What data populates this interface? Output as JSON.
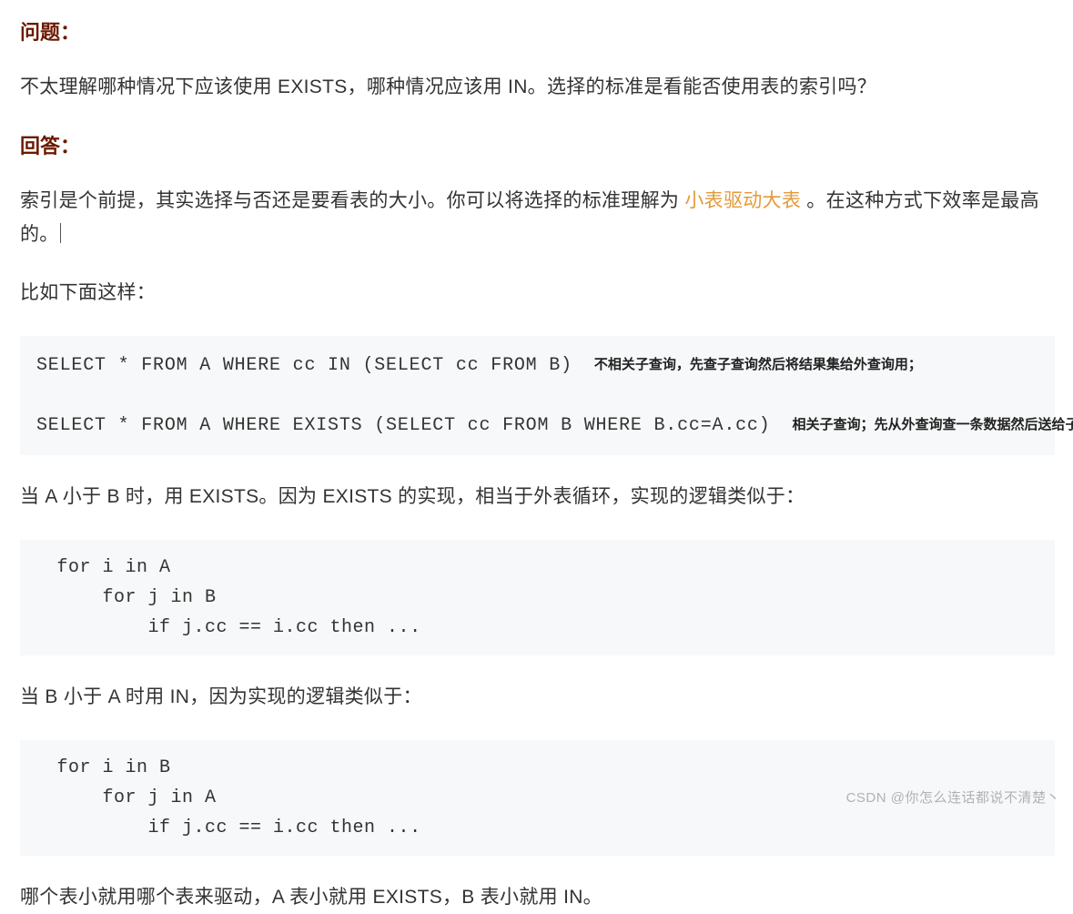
{
  "q_heading": "问题：",
  "q_text": "不太理解哪种情况下应该使用 EXISTS，哪种情况应该用 IN。选择的标准是看能否使用表的索引吗？",
  "a_heading": "回答：",
  "a_text_pre": "索引是个前提，其实选择与否还是要看表的大小。你可以将选择的标准理解为 ",
  "a_text_hl": "小表驱动大表",
  "a_text_post": " 。在这种方式下效率是最高的。",
  "example_intro": "比如下面这样：",
  "sql1_code": "SELECT * FROM A WHERE cc IN (SELECT cc FROM B)",
  "sql1_note": "不相关子查询，先查子查询然后将结果集给外查询用；",
  "sql2_code": "SELECT * FROM A WHERE EXISTS (SELECT cc FROM B WHERE B.cc=A.cc)",
  "sql2_note": "相关子查询；先从外查询查一条数据然后送给子查询",
  "explain1": "当 A 小于 B 时，用 EXISTS。因为 EXISTS 的实现，相当于外表循环，实现的逻辑类似于：",
  "loop1": " for i in A\n     for j in B\n         if j.cc == i.cc then ...",
  "explain2": "当 B 小于 A 时用 IN，因为实现的逻辑类似于：",
  "loop2": " for i in B\n     for j in A\n         if j.cc == i.cc then ...",
  "summary": "哪个表小就用哪个表来驱动，A 表小就用 EXISTS，B 表小就用 IN。",
  "watermark": "CSDN @你怎么连话都说不清楚丶"
}
